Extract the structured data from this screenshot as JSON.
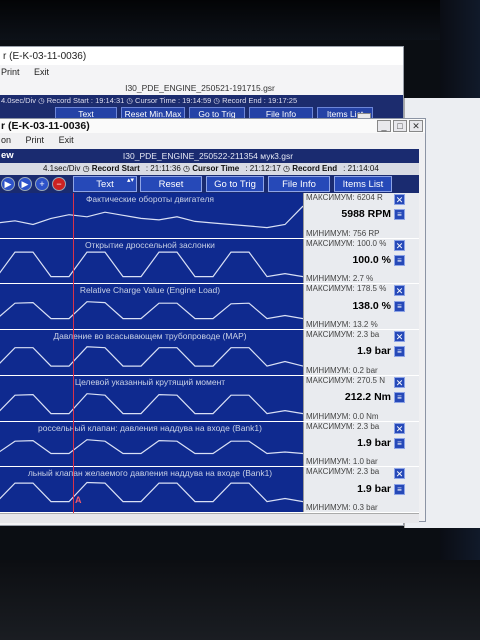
{
  "back_window": {
    "title": "r (E-K-03-11-0036)",
    "menu": [
      "Print",
      "Exit"
    ],
    "file_name": "I30_PDE_ENGINE_250521-191715.gsr",
    "status": {
      "scale": "4.0sec/Div",
      "record_start_label": "Record Start",
      "record_start": "19:14:31",
      "cursor_time_label": "Cursor Time",
      "cursor_time": "19:14:59",
      "record_end_label": "Record End",
      "record_end": "19:17:25"
    },
    "buttons": [
      "Text",
      "Reset Min.Max",
      "Go to Trig",
      "File Info",
      "Items List"
    ]
  },
  "front_window": {
    "title": "r (E-K-03-11-0036)",
    "menu": [
      "on",
      "Print",
      "Exit"
    ],
    "header": "ew",
    "file_name": "I30_PDE_ENGINE_250522-211354 мук3.gsr",
    "status": {
      "scale": "4.1sec/Div",
      "record_start_label": "Record Start",
      "record_start": "21:11:36",
      "cursor_time_label": "Cursor Time",
      "cursor_time": "21:12:17",
      "record_end_label": "Record End",
      "record_end": "21:14:04"
    },
    "toolbar": {
      "text_select": "Text",
      "reset_label": "Reset Min.Max",
      "goto_label": "Go to Trig",
      "fileinfo_label": "File Info",
      "items_label": "Items List"
    },
    "cursor_marker": "A",
    "signals": [
      {
        "name": "Фактические обороты двигателя",
        "max_label": "МАКСИМУМ:",
        "max": "6204 R",
        "value": "5988 RPM",
        "min_label": "МИНИМУМ:",
        "min": "756 RP"
      },
      {
        "name": "Открытие дроссельной заслонки",
        "max_label": "МАКСИМУМ:",
        "max": "100.0 %",
        "value": "100.0 %",
        "min_label": "МИНИМУМ:",
        "min": "2.7 %"
      },
      {
        "name": "Relative Charge Value (Engine Load)",
        "max_label": "МАКСИМУМ:",
        "max": "178.5 %",
        "value": "138.0 %",
        "min_label": "МИНИМУМ:",
        "min": "13.2 %"
      },
      {
        "name": "Давление во всасывающем трубопроводе (MAP)",
        "max_label": "МАКСИМУМ:",
        "max": "2.3 ba",
        "value": "1.9 bar",
        "min_label": "МИНИМУМ:",
        "min": "0.2 bar"
      },
      {
        "name": "Целевой указанный крутящий момент",
        "max_label": "МАКСИМУМ:",
        "max": "270.5 N",
        "value": "212.2 Nm",
        "min_label": "МИНИМУМ:",
        "min": "0.0 Nm"
      },
      {
        "name": "россельный клапан: давления наддува на входе (Bank1)",
        "max_label": "МАКСИМУМ:",
        "max": "2.3 ba",
        "value": "1.9 bar",
        "min_label": "МИНИМУМ:",
        "min": "1.0 bar"
      },
      {
        "name": "льный клапан желаемого давления наддува на входе (Bank1)",
        "max_label": "МАКСИМУМ:",
        "max": "2.3 ba",
        "value": "1.9 bar",
        "min_label": "МИНИМУМ:",
        "min": "0.3 bar"
      }
    ]
  },
  "colors": {
    "graph_bg": "#0f2a8f",
    "trace": "#d9e0f5",
    "cursor": "#d8324a",
    "readout_bg": "#e9ebef"
  }
}
